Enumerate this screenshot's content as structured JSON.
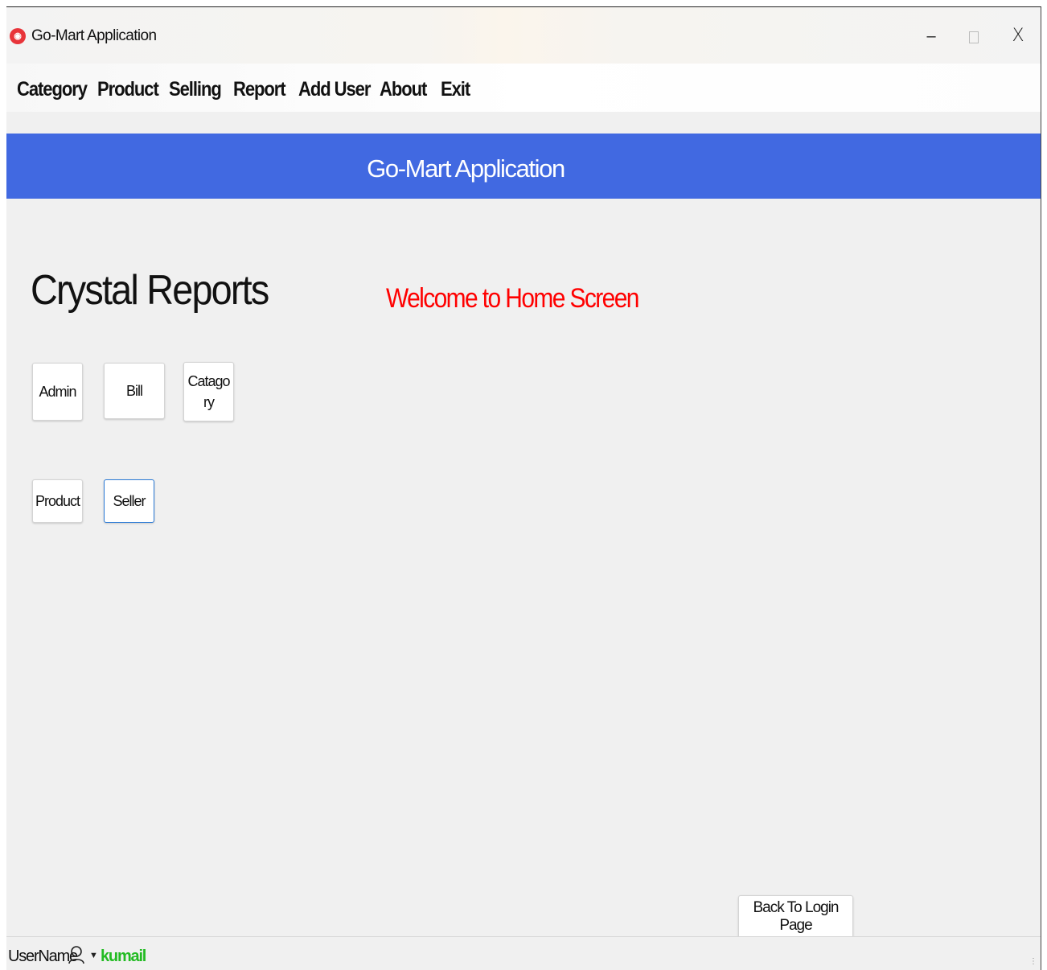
{
  "window": {
    "title": "Go-Mart Application",
    "controls": {
      "minimize": "–",
      "close": "X"
    }
  },
  "menu": {
    "items": [
      {
        "label": "Category"
      },
      {
        "label": "Product"
      },
      {
        "label": "Selling"
      },
      {
        "label": "Report"
      },
      {
        "label": "Add User"
      },
      {
        "label": "About"
      },
      {
        "label": "Exit"
      }
    ]
  },
  "banner": {
    "title": "Go-Mart Application",
    "color": "#4169e1"
  },
  "main": {
    "heading": "Crystal Reports",
    "welcome": "Welcome to Home Screen",
    "welcome_color": "#ff0000",
    "report_buttons": {
      "admin": "Admin",
      "bill": "Bill",
      "catagory": "Catagory",
      "product": "Product",
      "seller": "Seller"
    },
    "back_button": "Back To Login Page"
  },
  "status": {
    "label": "UserName",
    "username": "kumail",
    "username_color": "#22bb22"
  }
}
